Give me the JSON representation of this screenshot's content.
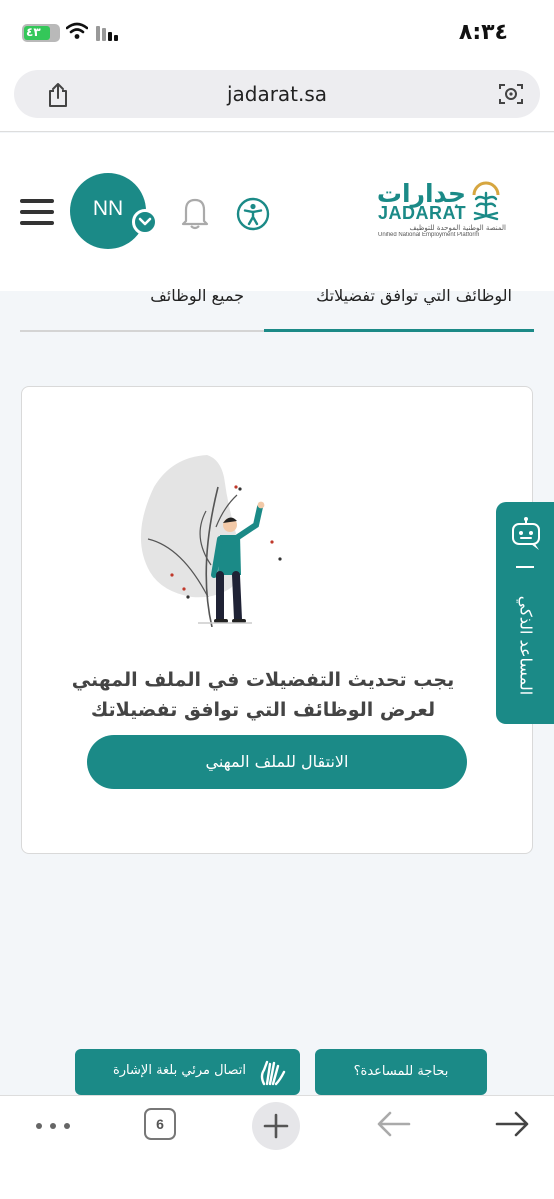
{
  "status_bar": {
    "time": "٨:٣٤",
    "battery": "٤٣"
  },
  "browser": {
    "url": "jadarat.sa",
    "tab_count": "6"
  },
  "header": {
    "avatar_initials": "NN",
    "logo": {
      "arabic": "جدارات",
      "english": "JADARAT",
      "subtitle_ar": "المنصة الوطنية الموحدة للتوظيف",
      "subtitle_en": "Unified National Employment Platform"
    }
  },
  "tabs": {
    "active": "الوظائف التي توافق تفضيلاتك",
    "all": "جميع الوظائف"
  },
  "card": {
    "message_line1": "يجب تحديث التفضيلات في الملف المهني",
    "message_line2": "لعرض الوظائف التي توافق تفضيلاتك",
    "button_label": "الانتقال للملف المهني"
  },
  "assistant": {
    "label": "المساعد الذكي"
  },
  "footer": {
    "help_label": "بحاجة للمساعدة؟",
    "sign_label": "اتصال مرئي بلغة الإشارة"
  },
  "colors": {
    "brand": "#1b8a87"
  }
}
